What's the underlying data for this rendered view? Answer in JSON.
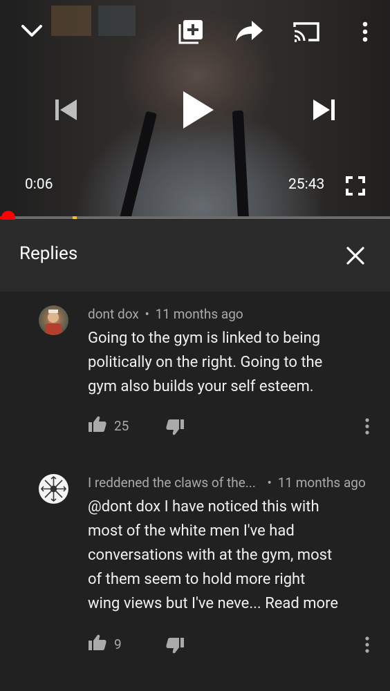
{
  "player": {
    "time_current": "0:06",
    "time_total": "25:43",
    "progress_fraction": 0.004
  },
  "replies_header": {
    "title": "Replies"
  },
  "comments": [
    {
      "author": "dont dox",
      "separator": "•",
      "time": "11 months ago",
      "lines": [
        "Going to the gym is linked to being",
        "politically on the right. Going to the",
        "gym also builds your self esteem."
      ],
      "likes": "25"
    },
    {
      "author": "I reddened the claws of the...",
      "separator": "•",
      "time": "11 months ago",
      "lines": [
        "@dont dox I have noticed this with",
        "most of the white men I've had",
        "conversations with at the gym, most",
        "of them seem to hold more right",
        "wing views but I've neve..."
      ],
      "read_more": "Read more",
      "likes": "9"
    }
  ],
  "colors": {
    "background": "#212121",
    "header_bg": "#2b2b2b",
    "progress_played": "#ff0000",
    "progress_ad_marker": "#f5c518",
    "meta_text": "#aaaaaa"
  }
}
